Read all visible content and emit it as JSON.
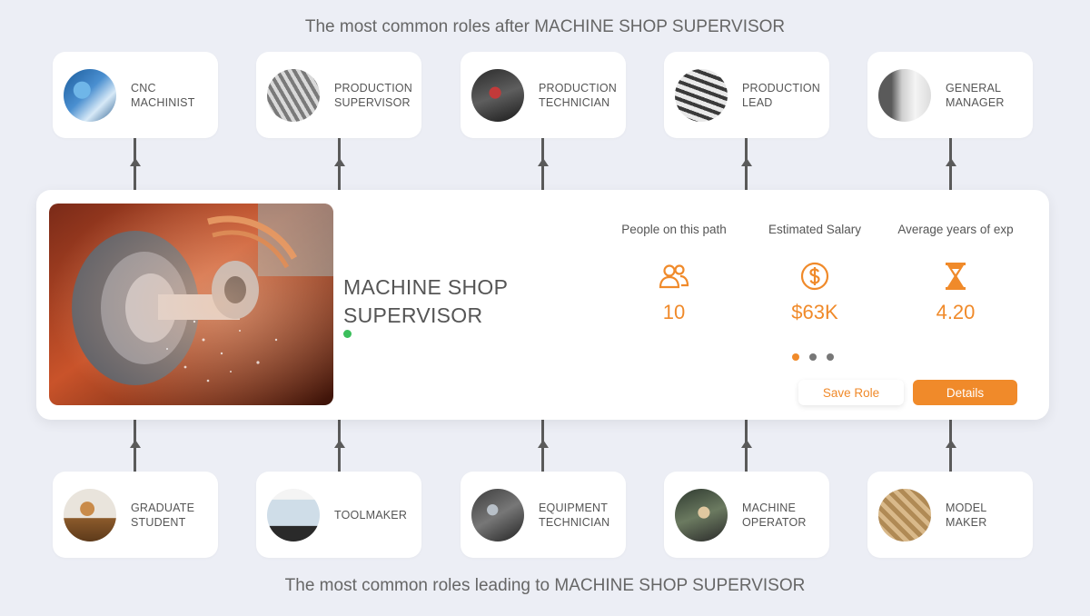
{
  "headings": {
    "after": "The most common roles after MACHINE SHOP SUPERVISOR",
    "before": "The most common roles leading to MACHINE SHOP SUPERVISOR"
  },
  "next_roles": [
    {
      "label": "CNC\nMACHINIST"
    },
    {
      "label": "PRODUCTION\nSUPERVISOR"
    },
    {
      "label": "PRODUCTION\nTECHNICIAN"
    },
    {
      "label": "PRODUCTION\nLEAD"
    },
    {
      "label": "GENERAL\nMANAGER"
    }
  ],
  "previous_roles": [
    {
      "label": "GRADUATE\nSTUDENT"
    },
    {
      "label": "TOOLMAKER"
    },
    {
      "label": "EQUIPMENT\nTECHNICIAN"
    },
    {
      "label": "MACHINE\nOPERATOR"
    },
    {
      "label": "MODEL\nMAKER"
    }
  ],
  "current_role": {
    "title": "MACHINE SHOP SUPERVISOR"
  },
  "stats": [
    {
      "label": "People on this path",
      "icon": "people-icon",
      "value": "10"
    },
    {
      "label": "Estimated Salary",
      "icon": "dollar-icon",
      "value": "$63K"
    },
    {
      "label": "Average years of exp",
      "icon": "hourglass-icon",
      "value": "4.20"
    }
  ],
  "actions": {
    "save_label": "Save Role",
    "details_label": "Details"
  },
  "colors": {
    "accent": "#f08a2a",
    "status_dot": "#3cbf5c",
    "background": "#eceef5"
  }
}
